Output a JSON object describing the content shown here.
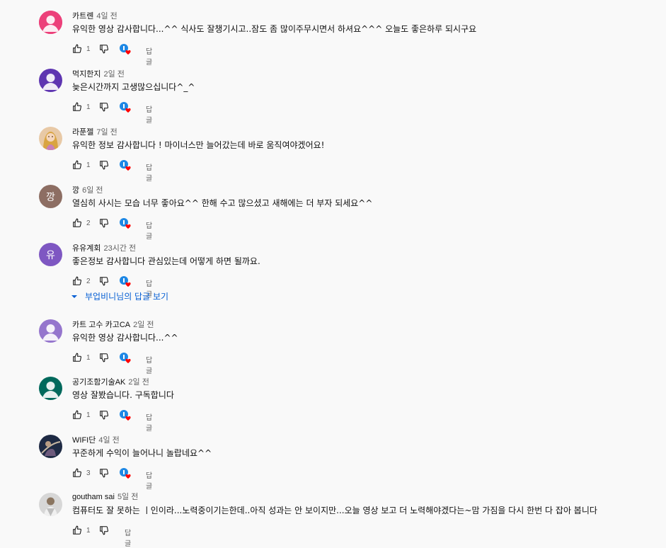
{
  "comments": [
    {
      "author": "카트롄",
      "time": "4일 전",
      "text": "유익한 영상 감사합니다...^^ 식사도 잘챙기시고..잠도 좀 많이주무시면서 하셔요^^^ 오늘도 좋은하루 되시구요",
      "likes": "1",
      "reply": "답글",
      "avatar": {
        "type": "person",
        "bg": "#ec407a"
      }
    },
    {
      "author": "먹지한지",
      "time": "2일 전",
      "text": "늦은시간까지 고생많으십니다^_^",
      "likes": "1",
      "reply": "답글",
      "avatar": {
        "type": "person",
        "bg": "#5e35b1"
      }
    },
    {
      "author": "라푼젤",
      "time": "7일 전",
      "text": "유익한 정보 감사합니다 ! 마이너스만 늘어갔는데 바로 움직여야겠어요!",
      "likes": "1",
      "reply": "답글",
      "avatar": {
        "type": "photo",
        "bg": "#e8c9a6"
      }
    },
    {
      "author": "깡",
      "time": "6일 전",
      "text": "열심히 사시는 모습 너무 좋아요^^  한해 수고 많으셨고 새해에는 더 부자 되세요^^",
      "likes": "2",
      "reply": "답글",
      "avatar": {
        "type": "letter",
        "letter": "깡",
        "bg": "#8d6e63"
      }
    },
    {
      "author": "유유계회",
      "time": "23시간 전",
      "text": "좋은정보 감사합니다 관심있는데 어떻게 하면 될까요.",
      "likes": "2",
      "reply": "답글",
      "avatar": {
        "type": "letter",
        "letter": "유",
        "bg": "#7e57c2"
      }
    },
    {
      "author": "카트 고수 카고CA",
      "time": "2일 전",
      "text": "유익한 영상 감사합니다...^^",
      "likes": "1",
      "reply": "답글",
      "avatar": {
        "type": "person",
        "bg": "#9575cd"
      }
    },
    {
      "author": "공기조함기술AK",
      "time": "2일 전",
      "text": "영상 잘봤습니다. 구독합니다",
      "likes": "1",
      "reply": "답글",
      "avatar": {
        "type": "person",
        "bg": "#00695c"
      }
    },
    {
      "author": "WIFI단",
      "time": "4일 전",
      "text": "꾸준하게 수익이 늘어나니 놀랍네요^^",
      "likes": "3",
      "reply": "답글",
      "avatar": {
        "type": "photo",
        "bg": "#1e2a44"
      }
    },
    {
      "author": "goutham sai",
      "time": "5일 전",
      "text": "컴퓨터도 잘 못하는  ㅣ인이라...노력중이기는한데..아직 성과는 안 보이지만...오늘 영상 보고 더 노력해야겠다는~맘 가짐을 다시 한번 다 잡아 봅니다",
      "likes": "1",
      "reply": "답글",
      "avatar": {
        "type": "photo",
        "bg": "#d7d7d7"
      }
    }
  ],
  "replies_toggle": {
    "label": "부업비니님의 답글 보기"
  },
  "colors": {
    "link": "#065fd4",
    "heart": "#ff0000",
    "creator_badge": "#1e88e5"
  }
}
